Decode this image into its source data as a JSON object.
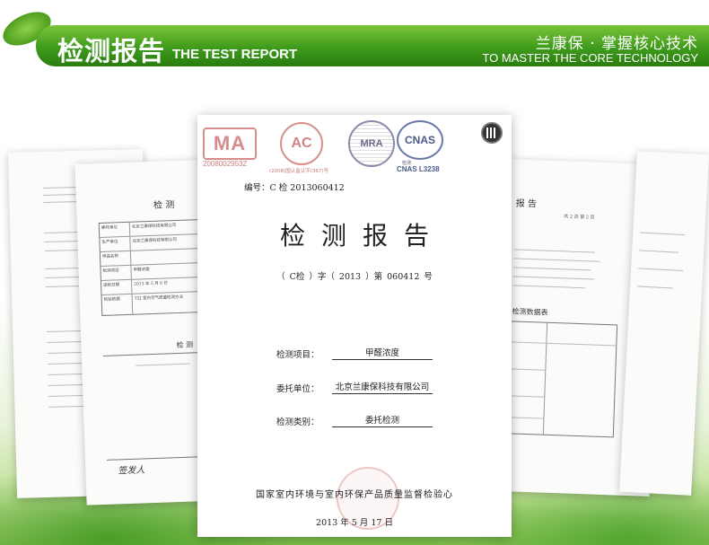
{
  "header": {
    "title_cn": "检测报告",
    "title_en": "THE TEST REPORT",
    "slogan_cn": "兰康保 · 掌握核心技术",
    "slogan_en": "TO MASTER THE CORE TECHNOLOGY"
  },
  "colors": {
    "banner_green": "#3e9b1b",
    "banner_text": "#ffffff"
  },
  "report": {
    "ma_number": "2008002953Z",
    "ac_caption": "(2008)国认监认字(367)号",
    "cnas_caption": "检测",
    "cnas_number": "CNAS L3238",
    "number_line": "编号：C 检 2013060412",
    "title": "检测报告",
    "code_line": "（ C检 ）字（ 2013 ）第 060412 号",
    "fields": [
      {
        "label": "检测项目：",
        "value": "甲醛浓度"
      },
      {
        "label": "委托单位：",
        "value": "北京兰康保科技有限公司"
      },
      {
        "label": "检测类别：",
        "value": "委托检测"
      }
    ],
    "footer": "国家室内环境与室内环保产品质量监督检验心",
    "date": "2013 年 5 月 17 日"
  },
  "side_docs": {
    "left_header": "检   测",
    "left_table_rows": [
      [
        "委托单位",
        "北京兰康保科技有限公司"
      ],
      [
        "生产单位",
        "北京兰康保科技有限公司"
      ],
      [
        "样品名称",
        ""
      ],
      [
        "检测项目",
        "甲醛浓度"
      ],
      [
        "送检日期",
        "2013 年 5 月 8 日"
      ],
      [
        "检验依据",
        "TZJ 室内空气质量检测方法"
      ]
    ],
    "left_mid": "检   测",
    "right_header": "报   告",
    "right_page": "共 2 页  第 2 页",
    "right_section": "检测数据表",
    "signature": "签发人"
  }
}
